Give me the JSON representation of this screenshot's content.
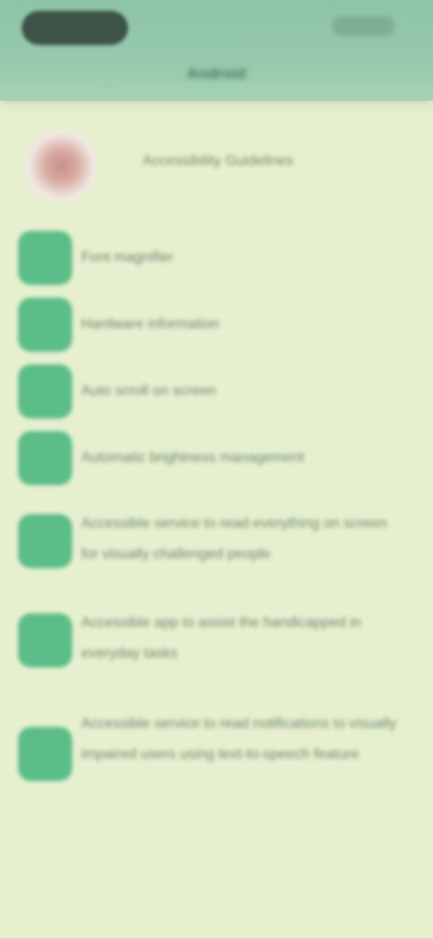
{
  "header": {
    "title": "Android"
  },
  "profile": {
    "name": "Accessibility Guidelines"
  },
  "menu": [
    {
      "label": "Font magnifier",
      "icon": "app-icon"
    },
    {
      "label": "Hardware information",
      "icon": "app-icon"
    },
    {
      "label": "Auto scroll on screen",
      "icon": "app-icon"
    },
    {
      "label": "Automatic brightness management",
      "icon": "app-icon"
    },
    {
      "label": "Accessible service to read everything on screen for visually challenged people",
      "icon": "app-icon"
    },
    {
      "label": "Accessible app to assist the handicapped in everyday tasks",
      "icon": "app-icon"
    },
    {
      "label": "Accessible service to read notifications to visually impaired users using text-to-speech feature",
      "icon": "app-icon"
    }
  ],
  "colors": {
    "background": "#e6f0cf",
    "header": "#95c8aa",
    "icon": "#5bbd87"
  }
}
